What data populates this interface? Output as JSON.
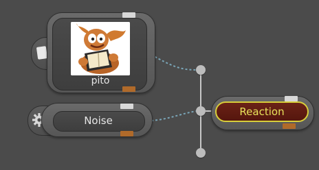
{
  "graph": {
    "nodes": {
      "pito": {
        "label": "pito",
        "tab_icon": "clip-icon",
        "thumbnail_icon": "character-thumbnail"
      },
      "noise": {
        "label": "Noise",
        "tab_icon": "gear-icon"
      },
      "reaction": {
        "label": "Reaction",
        "selected": true
      }
    },
    "colors": {
      "background": "#4b4b4b",
      "node_body": "#5f5f5f",
      "node_inner": "#444444",
      "port_white": "#d8d8d8",
      "port_orange": "#b06a2a",
      "reaction_fill": "#6b2217",
      "reaction_outline": "#d8cf3a",
      "reaction_text": "#e8e25a",
      "connection_dashed": "#7aa6b8",
      "connection_solid": "#c8c8c8"
    }
  }
}
